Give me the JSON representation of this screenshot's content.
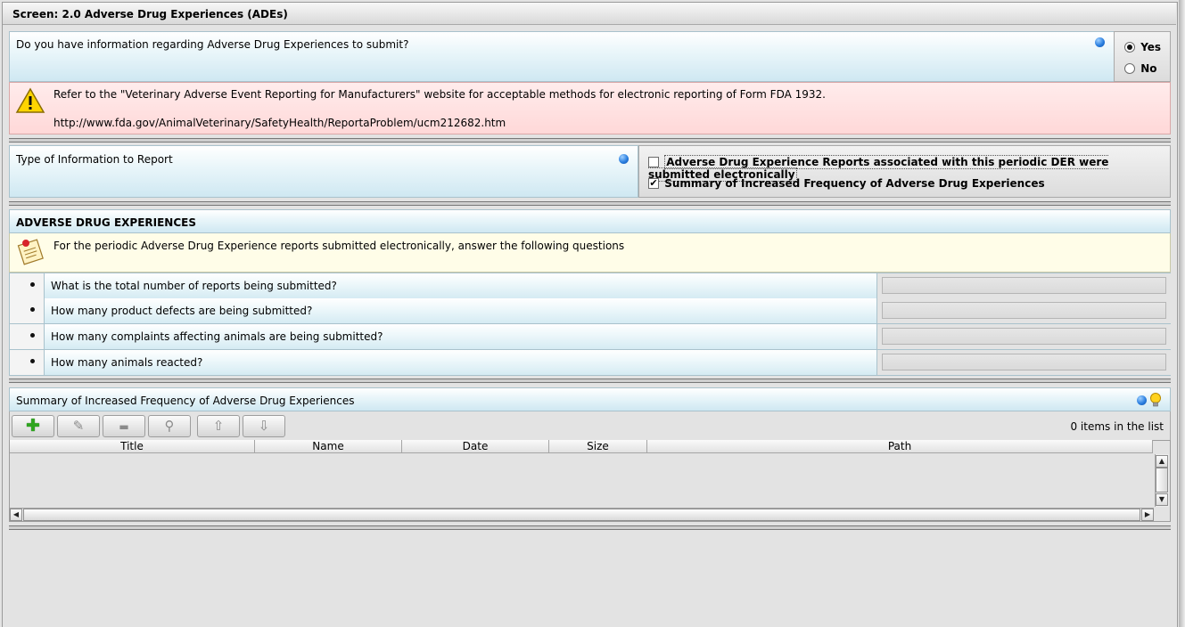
{
  "screen": {
    "title": "Screen: 2.0 Adverse Drug Experiences (ADEs)"
  },
  "ade_question": {
    "text": "Do you have information regarding Adverse Drug Experiences to submit?",
    "options": [
      {
        "label": "Yes",
        "selected": true
      },
      {
        "label": "No",
        "selected": false
      }
    ]
  },
  "warning": {
    "text": "Refer to the \"Veterinary Adverse Event Reporting for Manufacturers\" website for acceptable methods for electronic reporting of Form FDA 1932.",
    "url": "http://www.fda.gov/AnimalVeterinary/SafetyHealth/ReportaProblem/ucm212682.htm"
  },
  "type_info": {
    "label": "Type of Information to Report",
    "options": [
      {
        "label": "Adverse Drug Experience Reports associated with this periodic DER were submitted electronically",
        "checked": false
      },
      {
        "label": "Summary of Increased Frequency of Adverse Drug Experiences",
        "checked": true
      }
    ]
  },
  "ade_section": {
    "header": "ADVERSE DRUG EXPERIENCES",
    "note": "For the periodic Adverse Drug Experience reports submitted electronically, answer the following questions",
    "questions": [
      {
        "text": "What is the total number of reports being submitted?",
        "value": ""
      },
      {
        "text": "How many product defects are being submitted?",
        "value": ""
      },
      {
        "text": "How many complaints affecting animals are being submitted?",
        "value": ""
      },
      {
        "text": "How many animals reacted?",
        "value": ""
      }
    ]
  },
  "summary": {
    "header": "Summary of Increased Frequency of Adverse Drug Experiences",
    "count_text": "0 items in the list",
    "toolbar": [
      {
        "icon": "add-icon",
        "glyph": "✚",
        "enabled": true
      },
      {
        "icon": "edit-icon",
        "glyph": "✎",
        "enabled": false
      },
      {
        "icon": "remove-icon",
        "glyph": "▬",
        "enabled": false
      },
      {
        "icon": "view-icon",
        "glyph": "⚲",
        "enabled": false
      },
      {
        "icon": "move-up-icon",
        "glyph": "⇧",
        "enabled": false
      },
      {
        "icon": "move-down-icon",
        "glyph": "⇩",
        "enabled": false
      }
    ],
    "columns": [
      "Title",
      "Name",
      "Date",
      "Size",
      "Path"
    ],
    "rows": []
  },
  "colors": {
    "panel_blue": "#eaf6fa",
    "warning_pink": "#ffd8d8",
    "note_yellow": "#fffde8",
    "add_green": "#2fa51f",
    "info_blue": "#2b7fe0"
  }
}
